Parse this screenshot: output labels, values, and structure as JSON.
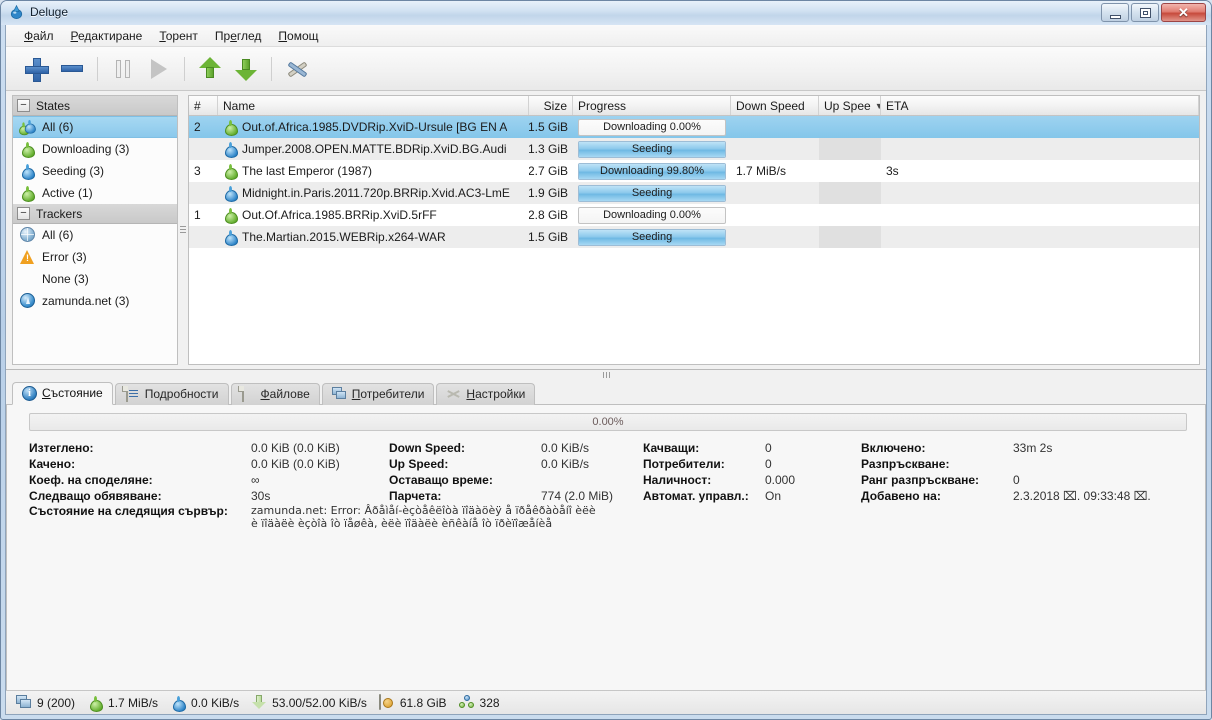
{
  "window": {
    "title": "Deluge",
    "app_icon": "deluge-drop-icon",
    "buttons": {
      "minimize": "minimize-icon",
      "maximize": "maximize-icon",
      "close": "✕"
    }
  },
  "menubar": [
    {
      "label": "Файл",
      "mnemonic": "Ф"
    },
    {
      "label": "Редактиране",
      "mnemonic": "Р"
    },
    {
      "label": "Торент",
      "mnemonic": "Т"
    },
    {
      "label": "Преглед",
      "mnemonic": "г"
    },
    {
      "label": "Помощ",
      "mnemonic": "П"
    }
  ],
  "toolbar": [
    {
      "name": "add-torrent-button",
      "icon": "plus-icon",
      "enabled": true
    },
    {
      "name": "remove-torrent-button",
      "icon": "minus-icon",
      "enabled": true
    },
    {
      "name": "pause-button",
      "icon": "pause-icon",
      "enabled": false
    },
    {
      "name": "resume-button",
      "icon": "play-icon",
      "enabled": false
    },
    {
      "name": "queue-up-button",
      "icon": "arrow-up-icon",
      "enabled": true
    },
    {
      "name": "queue-down-button",
      "icon": "arrow-down-icon",
      "enabled": true
    },
    {
      "name": "preferences-button",
      "icon": "wrench-icon",
      "enabled": true
    }
  ],
  "sidebar": {
    "groups": [
      {
        "header": "States",
        "expander": "−",
        "items": [
          {
            "label": "All (6)",
            "icon": "all-states-icon",
            "selected": true
          },
          {
            "label": "Downloading (3)",
            "icon": "download-drop-icon",
            "selected": false
          },
          {
            "label": "Seeding (3)",
            "icon": "upload-drop-icon",
            "selected": false
          },
          {
            "label": "Active (1)",
            "icon": "active-drop-icon",
            "selected": false
          }
        ]
      },
      {
        "header": "Trackers",
        "expander": "−",
        "items": [
          {
            "label": "All (6)",
            "icon": "globe-icon",
            "selected": false
          },
          {
            "label": "Error (3)",
            "icon": "warning-icon",
            "selected": false
          },
          {
            "label": "None (3)",
            "icon": "none-icon",
            "selected": false
          },
          {
            "label": "zamunda.net (3)",
            "icon": "tracker-icon",
            "selected": false
          }
        ]
      }
    ]
  },
  "table": {
    "columns": [
      {
        "key": "num",
        "label": "#",
        "sorted": false
      },
      {
        "key": "name",
        "label": "Name",
        "sorted": false
      },
      {
        "key": "size",
        "label": "Size",
        "sorted": false
      },
      {
        "key": "progress",
        "label": "Progress",
        "sorted": false
      },
      {
        "key": "down",
        "label": "Down Speed",
        "sorted": false
      },
      {
        "key": "up",
        "label": "Up Spee",
        "sorted": true,
        "sort_arrow": "▼"
      },
      {
        "key": "eta",
        "label": "ETA",
        "sorted": false
      }
    ],
    "rows": [
      {
        "num": "2",
        "icon": "download-drop-icon",
        "name": "Out.of.Africa.1985.DVDRip.XviD-Ursule [BG EN A",
        "size": "1.5 GiB",
        "progress_label": "Downloading 0.00%",
        "progress_pct": 0,
        "down": "",
        "up": "",
        "eta": "",
        "selected": true
      },
      {
        "num": "",
        "icon": "upload-drop-icon",
        "name": "Jumper.2008.OPEN.MATTE.BDRip.XviD.BG.Audi",
        "size": "1.3 GiB",
        "progress_label": "Seeding",
        "progress_pct": 100,
        "down": "",
        "up": "",
        "eta": "",
        "selected": false
      },
      {
        "num": "3",
        "icon": "download-drop-icon",
        "name": "The last Emperor (1987)",
        "size": "2.7 GiB",
        "progress_label": "Downloading 99.80%",
        "progress_pct": 99.8,
        "down": "1.7 MiB/s",
        "up": "",
        "eta": "3s",
        "selected": false
      },
      {
        "num": "",
        "icon": "upload-drop-icon",
        "name": "Midnight.in.Paris.2011.720p.BRRip.Xvid.AC3-LmE",
        "size": "1.9 GiB",
        "progress_label": "Seeding",
        "progress_pct": 100,
        "down": "",
        "up": "",
        "eta": "",
        "selected": false
      },
      {
        "num": "1",
        "icon": "download-drop-icon",
        "name": "Out.Of.Africa.1985.BRRip.XviD.5rFF",
        "size": "2.8 GiB",
        "progress_label": "Downloading 0.00%",
        "progress_pct": 0,
        "down": "",
        "up": "",
        "eta": "",
        "selected": false
      },
      {
        "num": "",
        "icon": "upload-drop-icon",
        "name": "The.Martian.2015.WEBRip.x264-WAR",
        "size": "1.5 GiB",
        "progress_label": "Seeding",
        "progress_pct": 100,
        "down": "",
        "up": "",
        "eta": "",
        "selected": false
      }
    ]
  },
  "tabs": [
    {
      "label": "Състояние",
      "icon": "info-icon",
      "active": true
    },
    {
      "label": "Подробности",
      "icon": "details-sheet-icon",
      "active": false
    },
    {
      "label": "Файлове",
      "icon": "files-sheet-icon",
      "active": false
    },
    {
      "label": "Потребители",
      "icon": "peers-monitors-icon",
      "active": false
    },
    {
      "label": "Настройки",
      "icon": "options-scissors-icon",
      "active": false
    }
  ],
  "details": {
    "progress": {
      "label": "0.00%",
      "pct": 0
    },
    "fields": [
      {
        "key": "Изтеглено:",
        "value": "0.0 KiB (0.0 KiB)"
      },
      {
        "key": "Down Speed:",
        "value": "0.0 KiB/s"
      },
      {
        "key": "Качващи:",
        "value": "0"
      },
      {
        "key": "Включено:",
        "value": "33m 2s"
      },
      {
        "key": "Качено:",
        "value": "0.0 KiB (0.0 KiB)"
      },
      {
        "key": "Up Speed:",
        "value": "0.0 KiB/s"
      },
      {
        "key": "Потребители:",
        "value": "0"
      },
      {
        "key": "Разпръскване:",
        "value": ""
      },
      {
        "key": "Коеф. на споделяне:",
        "value": "∞"
      },
      {
        "key": "Оставащо време:",
        "value": ""
      },
      {
        "key": "Наличност:",
        "value": "0.000"
      },
      {
        "key": "Ранг разпръскване:",
        "value": "0"
      },
      {
        "key": "Следващо обявяване:",
        "value": "30s"
      },
      {
        "key": "Парчета:",
        "value": "774 (2.0 MiB)"
      },
      {
        "key": "Автомат. управл.:",
        "value": "On"
      },
      {
        "key": "Добавено на:",
        "value": "2.3.2018 ⌧. 09:33:48 ⌧."
      }
    ],
    "tracker_status": {
      "key": "Състояние на следящия сървър:",
      "line1": "zamunda.net: Error: Âðåìåí-èçòåêëîòà ïîäàöèÿ å ïðåêðàòåíî èëè",
      "line2": "è ïîäàëè èçòîà îò ïåøêà, èëè ïîäàëè èñêàíå îò ïðèïîæåíèå"
    }
  },
  "statusbar": [
    {
      "icon": "connections-icon",
      "value": "9 (200)",
      "name": "connections-status"
    },
    {
      "icon": "download-drop-icon",
      "value": "1.7 MiB/s",
      "name": "download-speed-status"
    },
    {
      "icon": "upload-drop-icon",
      "value": "0.0 KiB/s",
      "name": "upload-speed-status"
    },
    {
      "icon": "protocol-traffic-icon",
      "value": "53.00/52.00 KiB/s",
      "name": "protocol-traffic-status"
    },
    {
      "icon": "disk-icon",
      "value": "61.8 GiB",
      "name": "free-space-status"
    },
    {
      "icon": "dht-peers-icon",
      "value": "328",
      "name": "dht-nodes-status"
    }
  ],
  "colors": {
    "accent": "#8cc9ec",
    "selection": "#9ed3f0",
    "title_close": "#c74a3c",
    "toolbar_blue": "#2f63a8",
    "arrow_green": "#6cb436"
  }
}
